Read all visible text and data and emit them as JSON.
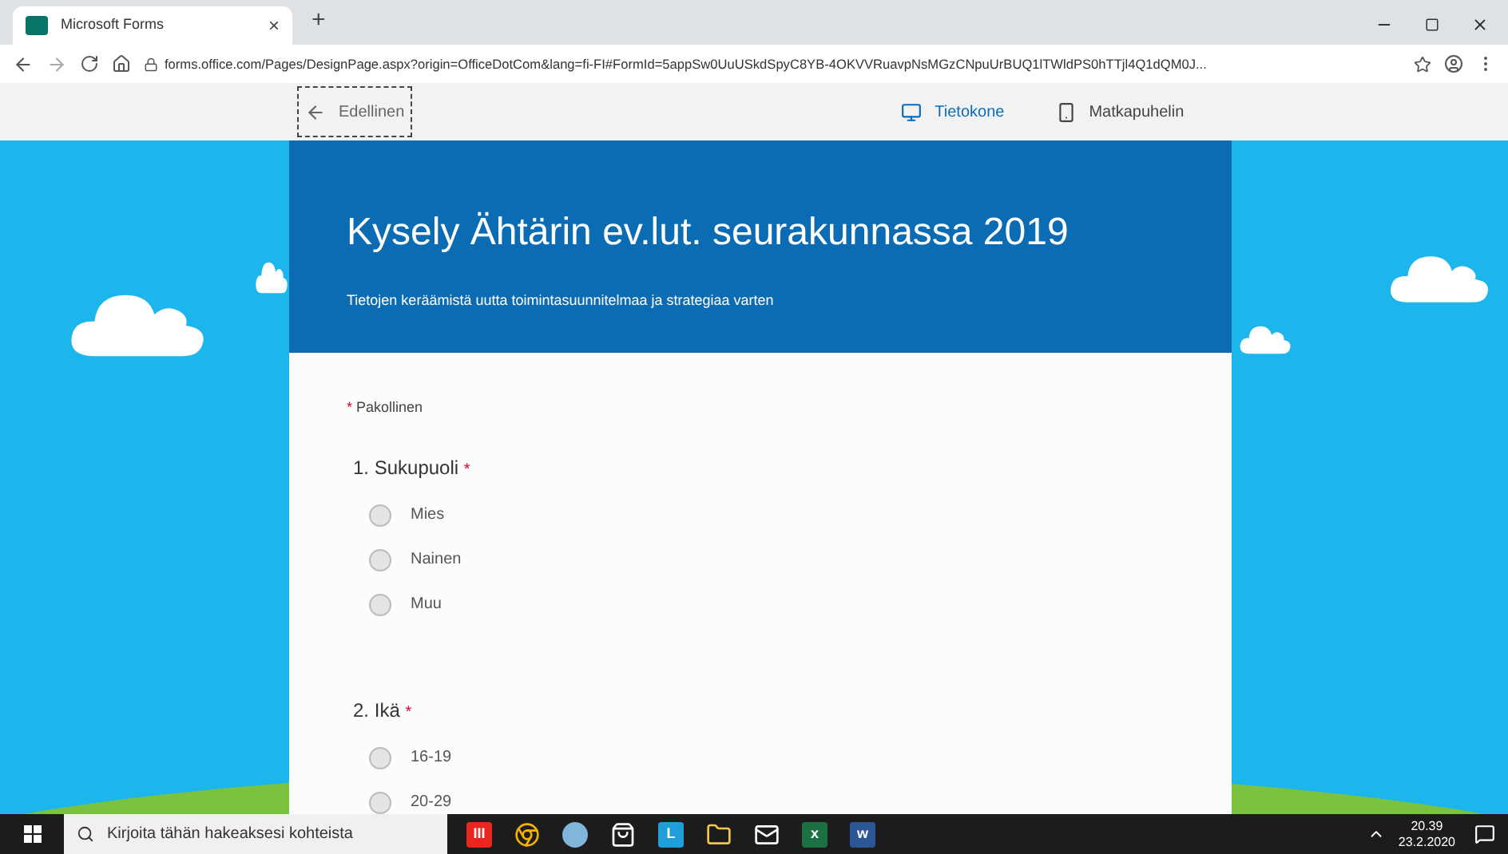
{
  "browser": {
    "tab": {
      "title": "Microsoft Forms",
      "close": "×"
    },
    "new_tab": "+",
    "url": "forms.office.com/Pages/DesignPage.aspx?origin=OfficeDotCom&lang=fi-FI#FormId=5appSw0UuUSkdSpyC8YB-4OKVVRuavpNsMGzCNpuUrBUQ1lTWldPS0hTTjl4Q1dQM0J..."
  },
  "toolbar": {
    "back": "Edellinen",
    "views": [
      {
        "label": "Tietokone",
        "kind": "desktop",
        "selected": true
      },
      {
        "label": "Matkapuhelin",
        "kind": "mobile",
        "selected": false
      }
    ]
  },
  "form": {
    "title": "Kysely Ähtärin ev.lut. seurakunnassa 2019",
    "subtitle": "Tietojen keräämistä uutta toimintasuunnitelmaa ja strategiaa varten",
    "required_note": "Pakollinen",
    "required_mark": "*",
    "questions": [
      {
        "number": "1.",
        "title": "Sukupuoli",
        "required": true,
        "options": [
          {
            "label": "Mies",
            "selected": false
          },
          {
            "label": "Nainen",
            "selected": false
          },
          {
            "label": "Muu",
            "selected": false
          }
        ]
      },
      {
        "number": "2.",
        "title": "Ikä",
        "required": true,
        "options": [
          {
            "label": "16-19",
            "selected": false
          },
          {
            "label": "20-29",
            "selected": false
          }
        ]
      }
    ]
  },
  "taskbar": {
    "search_placeholder": "Kirjoita tähän hakeaksesi kohteista",
    "apps": [
      {
        "kind": "office",
        "label": "III"
      },
      {
        "kind": "chrome"
      },
      {
        "kind": "paint"
      },
      {
        "kind": "store"
      },
      {
        "kind": "l",
        "label": "L"
      },
      {
        "kind": "folder"
      },
      {
        "kind": "mail"
      },
      {
        "kind": "excel",
        "label": "x"
      },
      {
        "kind": "word",
        "label": "w"
      }
    ],
    "time": "20.39",
    "date": "23.2.2020"
  }
}
